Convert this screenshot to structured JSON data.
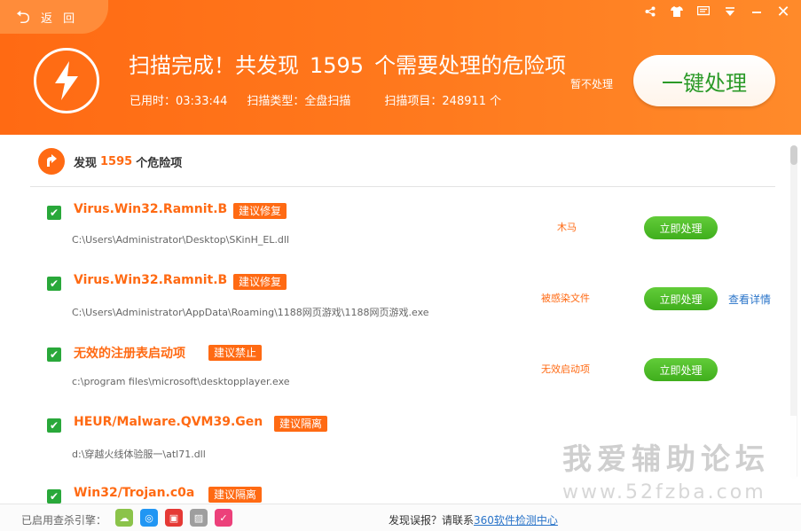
{
  "header": {
    "back_label": "返 回",
    "title_prefix": "扫描完成！共发现",
    "title_count": "1595",
    "title_suffix": "个需要处理的危险项",
    "elapsed": "已用时：03:33:44",
    "scan_type": "扫描类型：全盘扫描",
    "scan_items": "扫描项目：248911 个",
    "ignore_label": "暂不处理",
    "main_button": "一键处理",
    "accent_color": "#ff6a13"
  },
  "summary": {
    "prefix": "发现",
    "count": "1595",
    "suffix": "个危险项"
  },
  "items": [
    {
      "title": "Virus.Win32.Ramnit.B",
      "tag": "建议修复",
      "path": "C:\\Users\\Administrator\\Desktop\\SKinH_EL.dll",
      "type": "木马",
      "action": "立即处理",
      "detail": ""
    },
    {
      "title": "Virus.Win32.Ramnit.B",
      "tag": "建议修复",
      "path": "C:\\Users\\Administrator\\AppData\\Roaming\\1188网页游戏\\1188网页游戏.exe",
      "type": "被感染文件",
      "action": "立即处理",
      "detail": "查看详情"
    },
    {
      "title": "无效的注册表启动项",
      "tag": "建议禁止",
      "path": "c:\\program files\\microsoft\\desktopplayer.exe",
      "type": "无效启动项",
      "action": "立即处理",
      "detail": ""
    },
    {
      "title": "HEUR/Malware.QVM39.Gen",
      "tag": "建议隔离",
      "path": "d:\\穿越火线体验服一\\atl71.dll",
      "type": "",
      "action": "",
      "detail": ""
    },
    {
      "title": "Win32/Trojan.c0a",
      "tag": "建议隔离",
      "path": "",
      "type": "",
      "action": "",
      "detail": ""
    }
  ],
  "watermark": {
    "title": "我爱辅助论坛",
    "url": "www.52fzba.com"
  },
  "footer": {
    "engines_label": "已启用查杀引擎：",
    "report_prefix": "发现误报？请联系",
    "report_link": "360软件检测中心"
  }
}
